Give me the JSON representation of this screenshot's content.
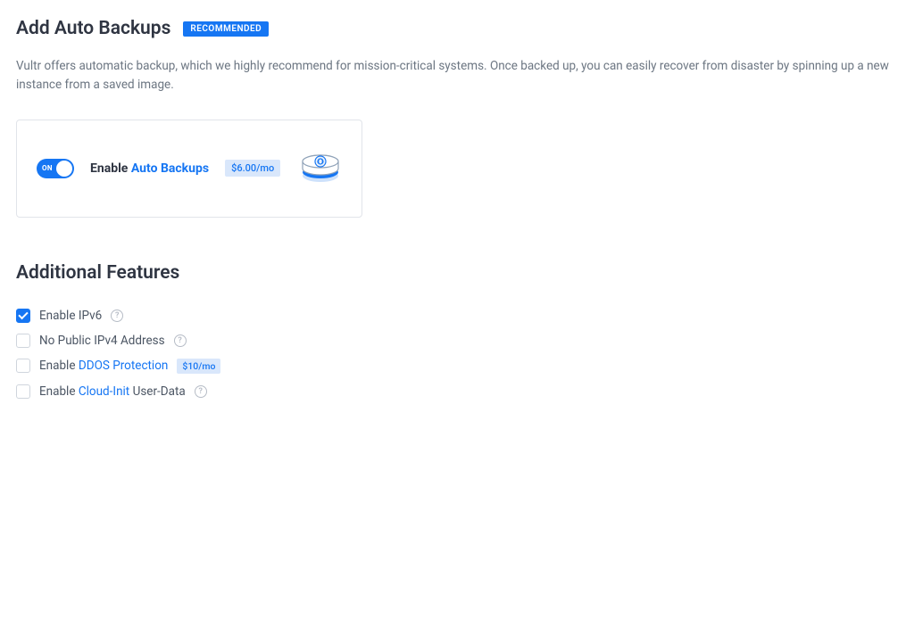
{
  "backups": {
    "title": "Add Auto Backups",
    "badge": "RECOMMENDED",
    "description": "Vultr offers automatic backup, which we highly recommend for mission-critical systems. Once backed up, you can easily recover from disaster by spinning up a new instance from a saved image.",
    "toggle_state": "ON",
    "enable_prefix": "Enable ",
    "enable_link": "Auto Backups",
    "price": "$6.00/mo"
  },
  "features": {
    "title": "Additional Features",
    "items": [
      {
        "checked": true,
        "label": "Enable IPv6",
        "link": "",
        "suffix": "",
        "price": "",
        "help": true
      },
      {
        "checked": false,
        "label": "No Public IPv4 Address",
        "link": "",
        "suffix": "",
        "price": "",
        "help": true
      },
      {
        "checked": false,
        "label": "Enable ",
        "link": "DDOS Protection",
        "suffix": "",
        "price": "$10/mo",
        "help": false
      },
      {
        "checked": false,
        "label": "Enable ",
        "link": "Cloud-Init",
        "suffix": " User-Data",
        "price": "",
        "help": true
      }
    ]
  }
}
